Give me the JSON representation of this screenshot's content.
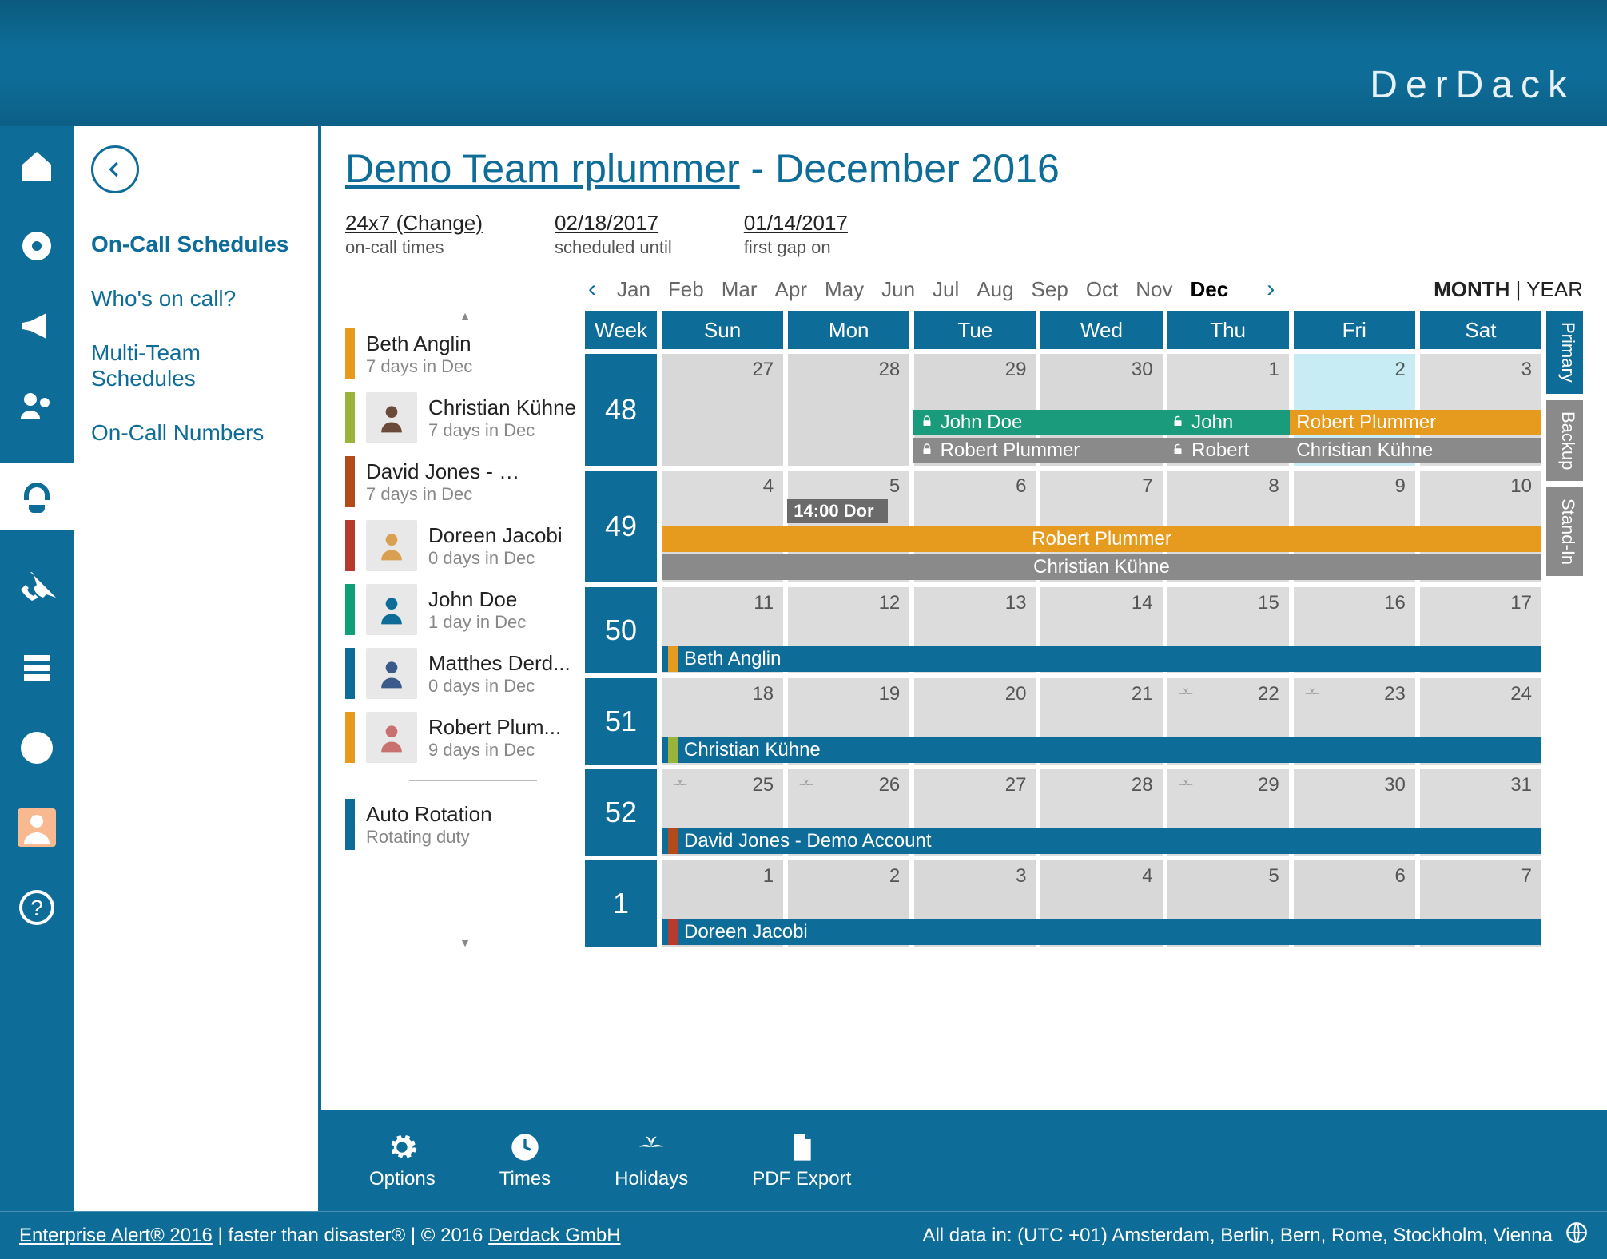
{
  "brand": "DerDack",
  "sidebar": {
    "items": [
      {
        "label": "On-Call Schedules",
        "active": true
      },
      {
        "label": "Who's on call?"
      },
      {
        "label": "Multi-Team Schedules"
      },
      {
        "label": "On-Call Numbers"
      }
    ]
  },
  "title": {
    "team": "Demo Team rplummer",
    "suffix": " - December 2016"
  },
  "meta": {
    "hours": {
      "top": "24x7 (Change)",
      "bottom": "on-call times"
    },
    "scheduled": {
      "top": "02/18/2017",
      "bottom": "scheduled until"
    },
    "gap": {
      "top": "01/14/2017",
      "bottom": "first gap on"
    }
  },
  "months": [
    "Jan",
    "Feb",
    "Mar",
    "Apr",
    "May",
    "Jun",
    "Jul",
    "Aug",
    "Sep",
    "Oct",
    "Nov",
    "Dec"
  ],
  "active_month": "Dec",
  "view_toggle": {
    "month": "MONTH",
    "sep": " | ",
    "year": "YEAR"
  },
  "day_headers": [
    "Week",
    "Sun",
    "Mon",
    "Tue",
    "Wed",
    "Thu",
    "Fri",
    "Sat"
  ],
  "people": [
    {
      "name": "Beth Anglin",
      "sub": "7 days in Dec",
      "color": "#e79b1e",
      "avatar": "none"
    },
    {
      "name": "Christian Kühne",
      "sub": "7 days in Dec",
      "color": "#9ab33a",
      "avatar": "man1"
    },
    {
      "name": "David Jones - Demo...",
      "sub": "7 days in Dec",
      "color": "#b24a1a",
      "avatar": "none"
    },
    {
      "name": "Doreen Jacobi",
      "sub": "0 days in Dec",
      "color": "#b73a2e",
      "avatar": "woman1"
    },
    {
      "name": "John Doe",
      "sub": "1 day in Dec",
      "color": "#0fa07a",
      "avatar": "silhouette"
    },
    {
      "name": "Matthes Derd...",
      "sub": "0 days in Dec",
      "color": "#0e6d98",
      "avatar": "man2"
    },
    {
      "name": "Robert Plum...",
      "sub": "9 days in Dec",
      "color": "#e79b1e",
      "avatar": "man3"
    }
  ],
  "auto_rotation": {
    "name": "Auto Rotation",
    "sub": "Rotating duty",
    "color": "#0e6d98"
  },
  "weeks": [
    {
      "num": "48",
      "days": [
        {
          "d": "27",
          "other": true
        },
        {
          "d": "28",
          "other": true
        },
        {
          "d": "29",
          "other": true
        },
        {
          "d": "30",
          "other": true
        },
        {
          "d": "1"
        },
        {
          "d": "2",
          "highlight": true
        },
        {
          "d": "3"
        }
      ]
    },
    {
      "num": "49",
      "days": [
        {
          "d": "4"
        },
        {
          "d": "5"
        },
        {
          "d": "6"
        },
        {
          "d": "7"
        },
        {
          "d": "8"
        },
        {
          "d": "9"
        },
        {
          "d": "10"
        }
      ]
    },
    {
      "num": "50",
      "days": [
        {
          "d": "11"
        },
        {
          "d": "12"
        },
        {
          "d": "13"
        },
        {
          "d": "14"
        },
        {
          "d": "15"
        },
        {
          "d": "16"
        },
        {
          "d": "17"
        }
      ]
    },
    {
      "num": "51",
      "days": [
        {
          "d": "18"
        },
        {
          "d": "19"
        },
        {
          "d": "20"
        },
        {
          "d": "21"
        },
        {
          "d": "22",
          "holiday": true
        },
        {
          "d": "23",
          "holiday": true
        },
        {
          "d": "24"
        }
      ]
    },
    {
      "num": "52",
      "days": [
        {
          "d": "25",
          "holiday": true
        },
        {
          "d": "26",
          "holiday": true
        },
        {
          "d": "27"
        },
        {
          "d": "28"
        },
        {
          "d": "29",
          "holiday": true
        },
        {
          "d": "30"
        },
        {
          "d": "31"
        }
      ]
    },
    {
      "num": "1",
      "days": [
        {
          "d": "1",
          "other": true
        },
        {
          "d": "2",
          "other": true
        },
        {
          "d": "3",
          "other": true
        },
        {
          "d": "4",
          "other": true
        },
        {
          "d": "5",
          "other": true
        },
        {
          "d": "6",
          "other": true
        },
        {
          "d": "7",
          "other": true
        }
      ]
    }
  ],
  "role_tabs": [
    "Primary",
    "Backup",
    "Stand-In"
  ],
  "timed_event": {
    "label": "14:00 Dor"
  },
  "assignments": {
    "w48": [
      {
        "label": "John Doe",
        "color": "#1a9c7c",
        "lock": true,
        "start": 2,
        "end": 4,
        "row": 0
      },
      {
        "label": "John",
        "color": "#1a9c7c",
        "half_lock": true,
        "start": 4,
        "end": 5,
        "row": 0
      },
      {
        "label": "Robert Plummer",
        "color": "#e79b1e",
        "start": 5,
        "end": 7,
        "row": 0
      },
      {
        "label": "Robert Plummer",
        "color": "#8a8a8a",
        "lock": true,
        "start": 2,
        "end": 4,
        "row": 1
      },
      {
        "label": "Robert",
        "color": "#8a8a8a",
        "half_lock": true,
        "start": 4,
        "end": 5,
        "row": 1
      },
      {
        "label": "Christian Kühne",
        "color": "#8a8a8a",
        "start": 5,
        "end": 7,
        "row": 1
      }
    ],
    "w49": [
      {
        "label": "Robert Plummer",
        "color": "#e79b1e",
        "start": 0,
        "end": 7,
        "row": 0,
        "center": true
      },
      {
        "label": "Christian Kühne",
        "color": "#8a8a8a",
        "start": 0,
        "end": 7,
        "row": 1,
        "center": true
      }
    ],
    "w50": [
      {
        "label": "Beth Anglin",
        "color": "#0e6d98",
        "sw": "#e79b1e",
        "start": 0,
        "end": 7,
        "row": 0
      }
    ],
    "w51": [
      {
        "label": "Christian Kühne",
        "color": "#0e6d98",
        "sw": "#9ab33a",
        "start": 0,
        "end": 7,
        "row": 0
      }
    ],
    "w52": [
      {
        "label": "David Jones - Demo Account",
        "color": "#0e6d98",
        "sw": "#b24a1a",
        "start": 0,
        "end": 7,
        "row": 0
      }
    ],
    "w1": [
      {
        "label": "Doreen Jacobi",
        "color": "#0e6d98",
        "sw": "#b73a2e",
        "start": 0,
        "end": 7,
        "row": 0
      }
    ]
  },
  "toolbar": {
    "options": "Options",
    "times": "Times",
    "holidays": "Holidays",
    "pdf": "PDF Export"
  },
  "footer": {
    "left_a": "Enterprise Alert® 2016",
    "left_b": " | faster than disaster® | © 2016  ",
    "left_c": "Derdack GmbH",
    "right": "All data in: (UTC +01) Amsterdam, Berlin, Bern, Rome, Stockholm, Vienna"
  }
}
